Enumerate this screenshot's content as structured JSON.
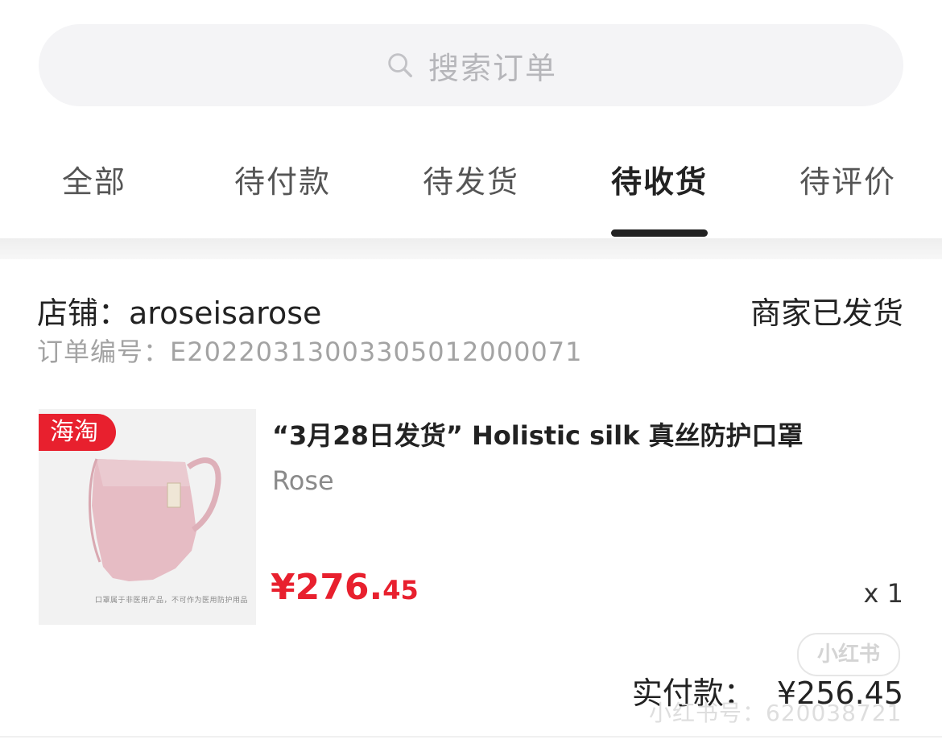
{
  "search": {
    "placeholder": "搜索订单"
  },
  "tabs": [
    {
      "label": "全部",
      "active": false
    },
    {
      "label": "待付款",
      "active": false
    },
    {
      "label": "待发货",
      "active": false
    },
    {
      "label": "待收货",
      "active": true
    },
    {
      "label": "待评价",
      "active": false
    }
  ],
  "order": {
    "shop_label": "店铺：",
    "shop_name": "aroseisarose",
    "status": "商家已发货",
    "number_label": "订单编号：",
    "number": "E20220313003305012000071",
    "product": {
      "badge": "海淘",
      "title": "“3月28日发货” Holistic silk 真丝防护口罩",
      "variant": "Rose",
      "price_main": "¥276.",
      "price_cents": "45",
      "quantity": "x 1",
      "image_caption": "口罩属于非医用产品，不可作为医用防护用品"
    },
    "paid_label": "实付款：",
    "paid_amount": "¥256.45"
  },
  "watermark": {
    "badge": "小红书",
    "id_text": "小红书号：620038721"
  },
  "colors": {
    "accent_red": "#e8202e",
    "text_dark": "#222222",
    "text_muted": "#a3a3a3",
    "mask_pink": "#e6bcc4"
  }
}
